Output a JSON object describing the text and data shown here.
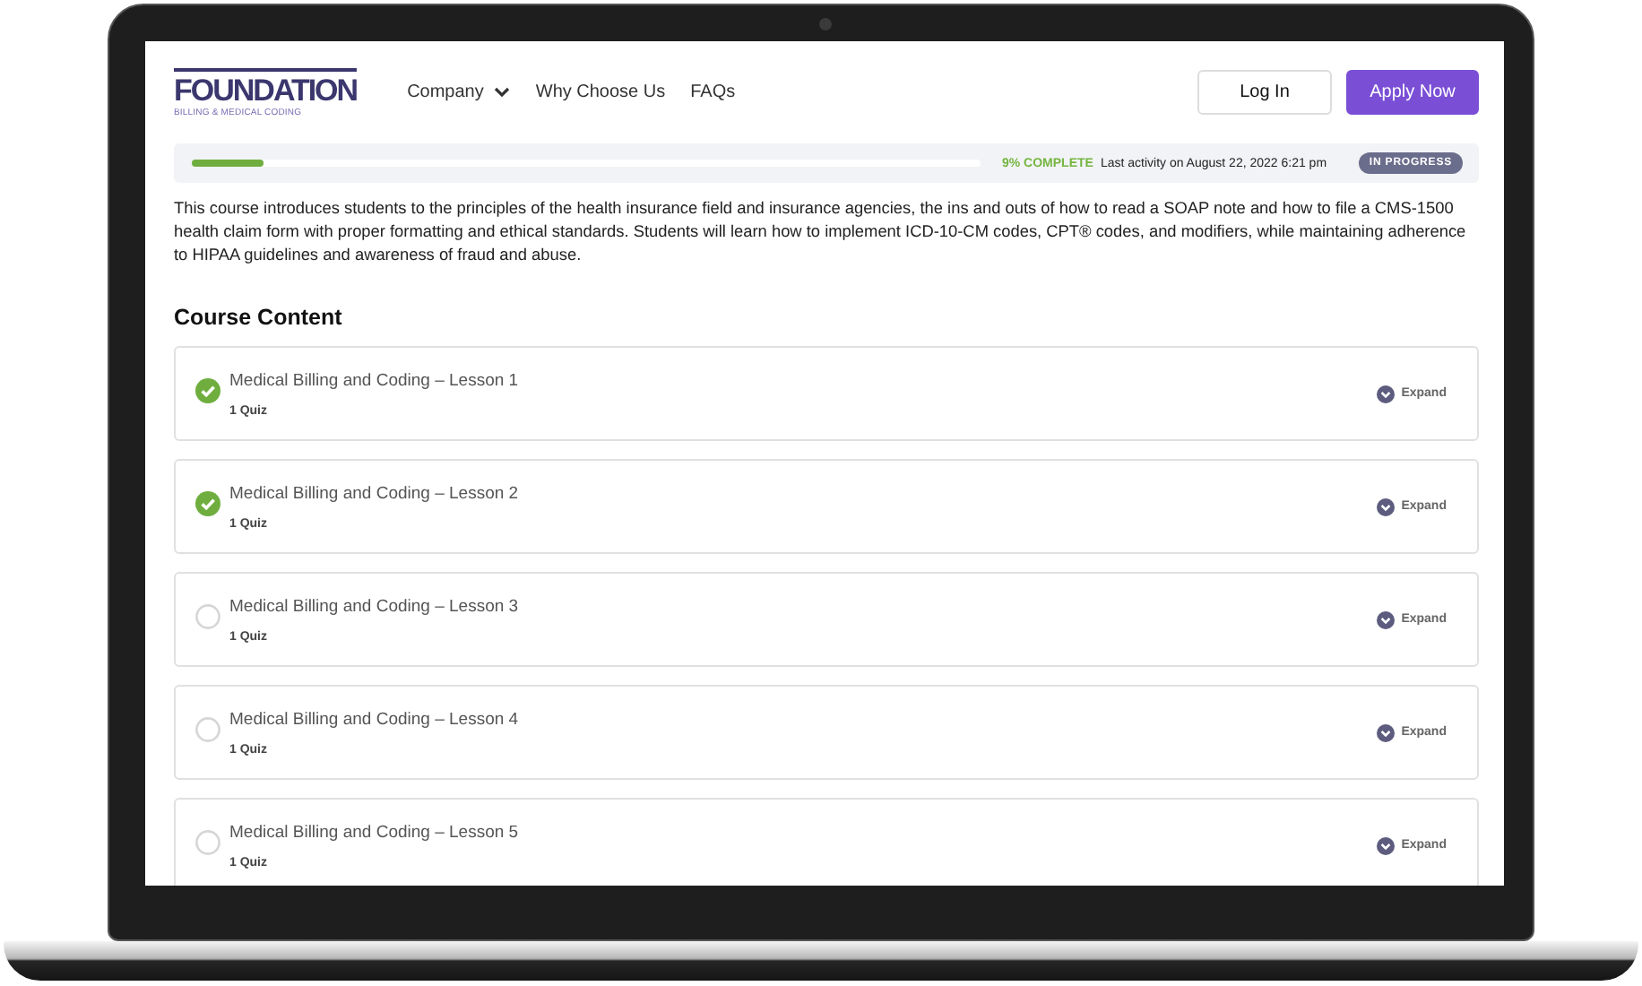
{
  "header": {
    "logo": {
      "title": "FOUNDATION",
      "subtitle": "BILLING & MEDICAL CODING"
    },
    "nav": [
      {
        "label": "Company",
        "dropdown": true
      },
      {
        "label": "Why Choose Us",
        "dropdown": false
      },
      {
        "label": "FAQs",
        "dropdown": false
      }
    ],
    "buttons": [
      {
        "label": "Log In",
        "kind": "outline"
      },
      {
        "label": "Apply Now",
        "kind": "primary"
      }
    ]
  },
  "progress": {
    "level": 0.09,
    "percent": "9% COMPLETE",
    "activity": "Last activity on August 22, 2022 6:21 pm",
    "status": "IN PROGRESS"
  },
  "description": "This course introduces students to the principles of the health insurance field and insurance agencies, the ins and outs of how to read a SOAP note and how to file a CMS-1500 health claim form with proper formatting and ethical standards. Students will learn how to implement ICD-10-CM codes, CPT®  codes, and modifiers, while maintaining adherence to HIPAA guidelines and awareness of fraud and abuse.",
  "course_content": {
    "title": "Course Content",
    "lessons": [
      {
        "title": "Medical Billing and Coding – Lesson 1",
        "meta": "1 Quiz",
        "completed": true,
        "action": "Expand"
      },
      {
        "title": "Medical Billing and Coding – Lesson 2",
        "meta": "1 Quiz",
        "completed": true,
        "action": "Expand"
      },
      {
        "title": "Medical Billing and Coding – Lesson 3",
        "meta": "1 Quiz",
        "completed": false,
        "action": "Expand"
      },
      {
        "title": "Medical Billing and Coding – Lesson 4",
        "meta": "1 Quiz",
        "completed": false,
        "action": "Expand"
      },
      {
        "title": "Medical Billing and Coding – Lesson 5",
        "meta": "1 Quiz",
        "completed": false,
        "action": "Expand"
      }
    ]
  }
}
